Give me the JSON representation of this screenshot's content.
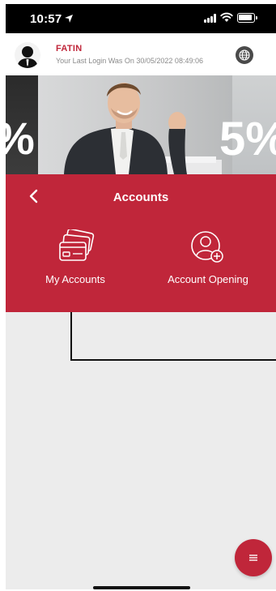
{
  "status_bar": {
    "time": "10:57"
  },
  "user": {
    "name": "FATIN",
    "last_login": "Your Last Login Was On 30/05/2022 08:49:06"
  },
  "banner": {
    "left_text": "%",
    "right_text": "5%"
  },
  "accounts": {
    "title": "Accounts",
    "tiles": [
      {
        "label": "My Accounts",
        "icon": "cards-icon"
      },
      {
        "label": "Account Opening",
        "icon": "user-add-icon"
      }
    ]
  },
  "colors": {
    "brand_red": "#c0263a",
    "background": "#ececec"
  }
}
